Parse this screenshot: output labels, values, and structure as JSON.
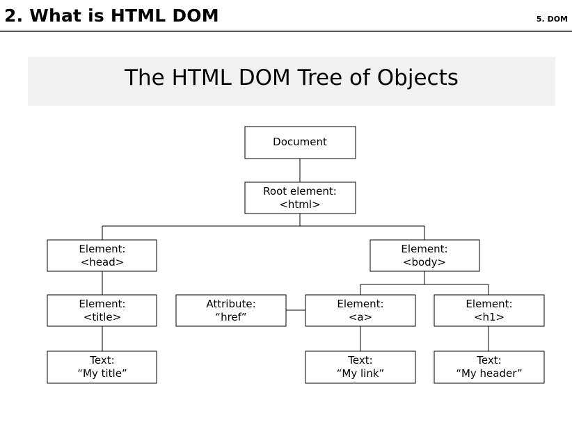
{
  "header": {
    "title": "2. What is HTML DOM",
    "section": "5. DOM"
  },
  "diagram": {
    "title": "The HTML DOM Tree of Objects",
    "nodes": {
      "document": [
        "Document"
      ],
      "root": [
        "Root element:",
        "<html>"
      ],
      "head": [
        "Element:",
        "<head>"
      ],
      "body": [
        "Element:",
        "<body>"
      ],
      "title": [
        "Element:",
        "<title>"
      ],
      "attribute": [
        "Attribute:",
        "“href”"
      ],
      "a": [
        "Element:",
        "<a>"
      ],
      "h1": [
        "Element:",
        "<h1>"
      ],
      "text_title": [
        "Text:",
        "“My title”"
      ],
      "text_link": [
        "Text:",
        "“My link”"
      ],
      "text_header": [
        "Text:",
        "“My header”"
      ]
    }
  }
}
